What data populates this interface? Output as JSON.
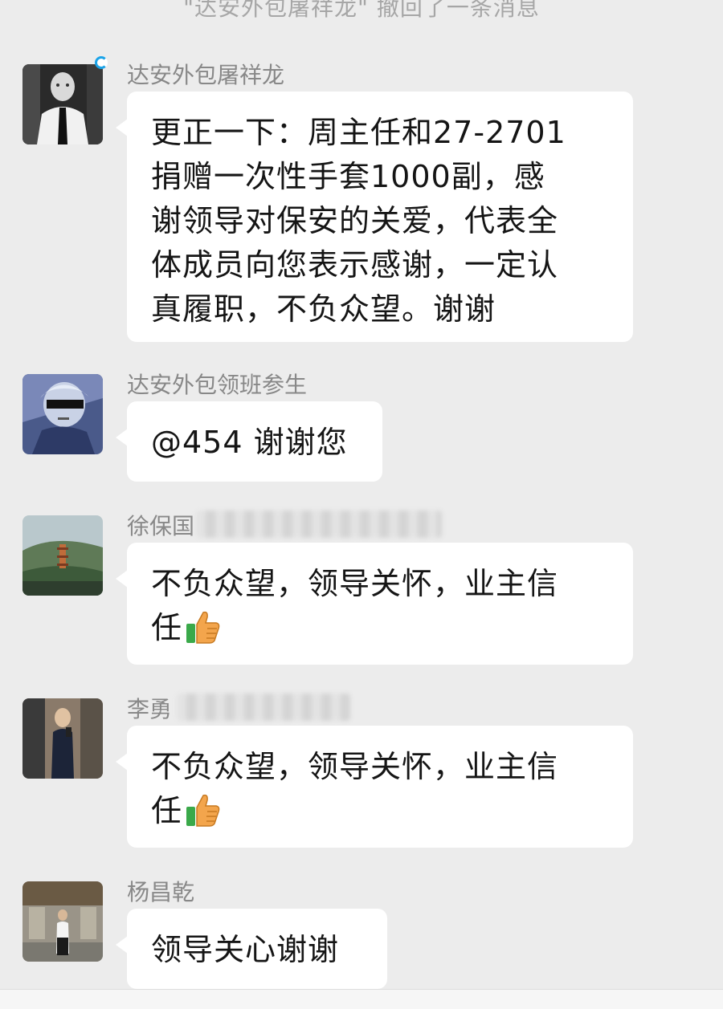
{
  "system_notice": "\"达安外包屠祥龙\" 撤回了一条消息",
  "messages": [
    {
      "sender": "达安外包屠祥龙",
      "text": "更正一下：周主任和27-2701\n捐赠一次性手套1000副，感\n谢领导对保安的关爱，代表全\n体成员向您表示感谢，一定认\n真履职，不负众望。谢谢"
    },
    {
      "sender": "达安外包领班参生",
      "text": "@454 谢谢您"
    },
    {
      "sender": "徐保国",
      "text": "不负众望，领导关怀，业主信\n任"
    },
    {
      "sender": "李勇",
      "text": "不负众望，领导关怀，业主信\n任"
    },
    {
      "sender": "杨昌乾",
      "text": "领导关心谢谢"
    }
  ],
  "icons": {
    "thumbs_up": "thumbs-up-emoji",
    "status": "refresh-status-icon"
  },
  "colors": {
    "background": "#ececec",
    "bubble": "#ffffff",
    "sender_name": "#888888",
    "notice": "#a6a6a6",
    "status_ring": "#1aa3e8"
  }
}
